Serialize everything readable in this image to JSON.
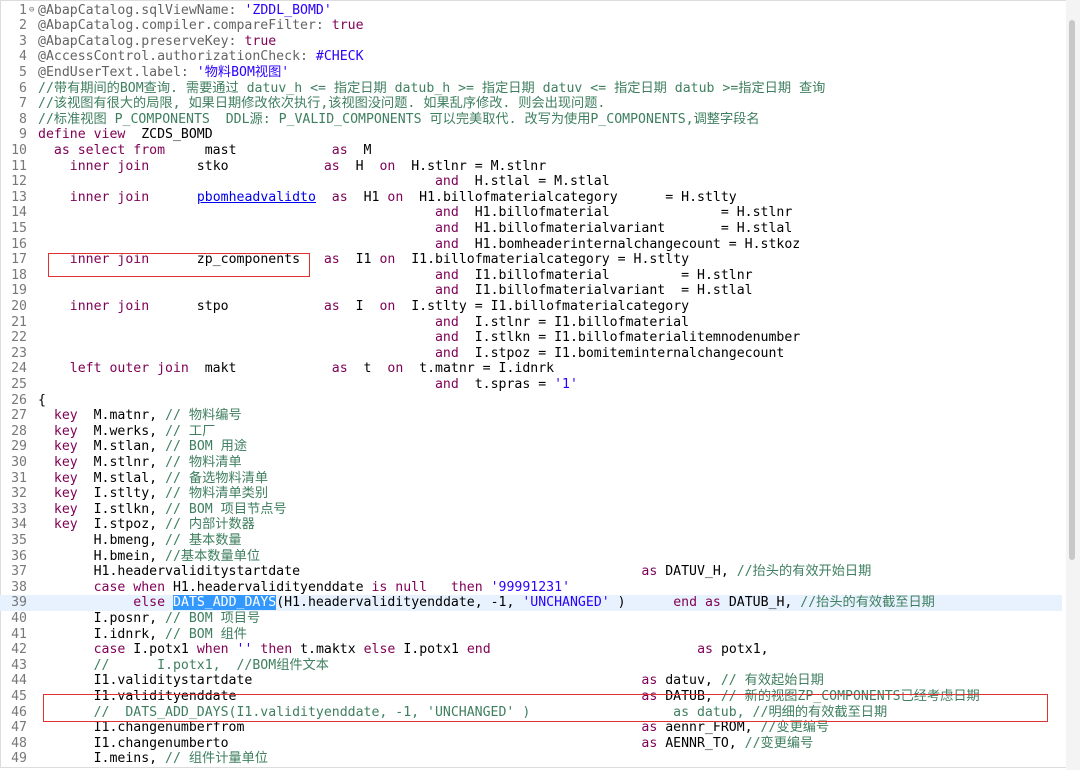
{
  "editor": {
    "lines": [
      [
        [
          "an",
          "@AbapCatalog.sqlViewName: "
        ],
        [
          "str",
          "'ZDDL_BOMD'"
        ]
      ],
      [
        [
          "an",
          "@AbapCatalog.compiler.compareFilter: "
        ],
        [
          "kw",
          "true"
        ]
      ],
      [
        [
          "an",
          "@AbapCatalog.preserveKey: "
        ],
        [
          "kw",
          "true"
        ]
      ],
      [
        [
          "an",
          "@AccessControl.authorizationCheck: "
        ],
        [
          "str",
          "#CHECK"
        ]
      ],
      [
        [
          "an",
          "@EndUserText.label: "
        ],
        [
          "str",
          "'物料BOM视图'"
        ]
      ],
      [
        [
          "cm",
          "//带有期间的BOM查询. 需要通过 datuv_h <= 指定日期 datub_h >= 指定日期 datuv <= 指定日期 datub >=指定日期 查询"
        ]
      ],
      [
        [
          "cm",
          "//该视图有很大的局限, 如果日期修改依次执行,该视图没问题. 如果乱序修改. 则会出现问题."
        ]
      ],
      [
        [
          "cm",
          "//标准视图 P_COMPONENTS  DDL源: P_VALID_COMPONENTS 可以完美取代. 改写为使用P_COMPONENTS,调整字段名"
        ]
      ],
      [
        [
          "kw",
          "define view"
        ],
        [
          "",
          "  ZCDS_BOMD"
        ]
      ],
      [
        [
          "",
          "  "
        ],
        [
          "kw",
          "as select from"
        ],
        [
          "",
          "     mast            "
        ],
        [
          "kw",
          "as"
        ],
        [
          "",
          "  M"
        ]
      ],
      [
        [
          "",
          "    "
        ],
        [
          "kw",
          "inner join"
        ],
        [
          "",
          "      stko            "
        ],
        [
          "kw",
          "as"
        ],
        [
          "",
          "  H  "
        ],
        [
          "kw",
          "on"
        ],
        [
          "",
          "  H.stlnr = M.stlnr"
        ]
      ],
      [
        [
          "",
          "                                                  "
        ],
        [
          "kw",
          "and"
        ],
        [
          "",
          "  H.stlal = M.stlal"
        ]
      ],
      [
        [
          "",
          "    "
        ],
        [
          "kw",
          "inner join"
        ],
        [
          "",
          "      "
        ],
        [
          "lnk",
          "pbomheadvalidto"
        ],
        [
          "",
          "  "
        ],
        [
          "kw",
          "as"
        ],
        [
          "",
          "  H1 "
        ],
        [
          "kw",
          "on"
        ],
        [
          "",
          "  H1.billofmaterialcategory      = H.stlty"
        ]
      ],
      [
        [
          "",
          "                                                  "
        ],
        [
          "kw",
          "and"
        ],
        [
          "",
          "  H1.billofmaterial              = H.stlnr"
        ]
      ],
      [
        [
          "",
          "                                                  "
        ],
        [
          "kw",
          "and"
        ],
        [
          "",
          "  H1.billofmaterialvariant       = H.stlal"
        ]
      ],
      [
        [
          "",
          "                                                  "
        ],
        [
          "kw",
          "and"
        ],
        [
          "",
          "  H1.bomheaderinternalchangecount = H.stkoz"
        ]
      ],
      [
        [
          "",
          "    "
        ],
        [
          "kw",
          "inner join"
        ],
        [
          "",
          "      zp_components   "
        ],
        [
          "kw",
          "as"
        ],
        [
          "",
          "  I1 "
        ],
        [
          "kw",
          "on"
        ],
        [
          "",
          "  I1.billofmaterialcategory = H.stlty"
        ]
      ],
      [
        [
          "",
          "                                                  "
        ],
        [
          "kw",
          "and"
        ],
        [
          "",
          "  I1.billofmaterial         = H.stlnr"
        ]
      ],
      [
        [
          "",
          "                                                  "
        ],
        [
          "kw",
          "and"
        ],
        [
          "",
          "  I1.billofmaterialvariant  = H.stlal"
        ]
      ],
      [
        [
          "",
          "    "
        ],
        [
          "kw",
          "inner join"
        ],
        [
          "",
          "      stpo            "
        ],
        [
          "kw",
          "as"
        ],
        [
          "",
          "  I  "
        ],
        [
          "kw",
          "on"
        ],
        [
          "",
          "  I.stlty = I1.billofmaterialcategory"
        ]
      ],
      [
        [
          "",
          "                                                  "
        ],
        [
          "kw",
          "and"
        ],
        [
          "",
          "  I.stlnr = I1.billofmaterial"
        ]
      ],
      [
        [
          "",
          "                                                  "
        ],
        [
          "kw",
          "and"
        ],
        [
          "",
          "  I.stlkn = I1.billofmaterialitemnodenumber"
        ]
      ],
      [
        [
          "",
          "                                                  "
        ],
        [
          "kw",
          "and"
        ],
        [
          "",
          "  I.stpoz = I1.bomiteminternalchangecount"
        ]
      ],
      [
        [
          "",
          "    "
        ],
        [
          "kw",
          "left outer join"
        ],
        [
          "",
          "  makt            "
        ],
        [
          "kw",
          "as"
        ],
        [
          "",
          "  t  "
        ],
        [
          "kw",
          "on"
        ],
        [
          "",
          "  t.matnr = I.idnrk"
        ]
      ],
      [
        [
          "",
          "                                                  "
        ],
        [
          "kw",
          "and"
        ],
        [
          "",
          "  t.spras = "
        ],
        [
          "str",
          "'1'"
        ]
      ],
      [
        [
          "",
          "{"
        ]
      ],
      [
        [
          "",
          "  "
        ],
        [
          "kw",
          "key"
        ],
        [
          "",
          "  M.matnr, "
        ],
        [
          "cm",
          "// 物料编号"
        ]
      ],
      [
        [
          "",
          "  "
        ],
        [
          "kw",
          "key"
        ],
        [
          "",
          "  M.werks, "
        ],
        [
          "cm",
          "// 工厂"
        ]
      ],
      [
        [
          "",
          "  "
        ],
        [
          "kw",
          "key"
        ],
        [
          "",
          "  M.stlan, "
        ],
        [
          "cm",
          "// BOM 用途"
        ]
      ],
      [
        [
          "",
          "  "
        ],
        [
          "kw",
          "key"
        ],
        [
          "",
          "  M.stlnr, "
        ],
        [
          "cm",
          "// 物料清单"
        ]
      ],
      [
        [
          "",
          "  "
        ],
        [
          "kw",
          "key"
        ],
        [
          "",
          "  M.stlal, "
        ],
        [
          "cm",
          "// 备选物料清单"
        ]
      ],
      [
        [
          "",
          "  "
        ],
        [
          "kw",
          "key"
        ],
        [
          "",
          "  I.stlty, "
        ],
        [
          "cm",
          "// 物料清单类别"
        ]
      ],
      [
        [
          "",
          "  "
        ],
        [
          "kw",
          "key"
        ],
        [
          "",
          "  I.stlkn, "
        ],
        [
          "cm",
          "// BOM 项目节点号"
        ]
      ],
      [
        [
          "",
          "  "
        ],
        [
          "kw",
          "key"
        ],
        [
          "",
          "  I.stpoz, "
        ],
        [
          "cm",
          "// 内部计数器"
        ]
      ],
      [
        [
          "",
          "       H.bmeng, "
        ],
        [
          "cm",
          "// 基本数量"
        ]
      ],
      [
        [
          "",
          "       H.bmein, "
        ],
        [
          "cm",
          "//基本数量单位"
        ]
      ],
      [
        [
          "",
          "       H1.headervaliditystartdate                                           "
        ],
        [
          "kw",
          "as"
        ],
        [
          "",
          " DATUV_H, "
        ],
        [
          "cm",
          "//抬头的有效开始日期"
        ]
      ],
      [
        [
          "",
          "       "
        ],
        [
          "kw",
          "case when"
        ],
        [
          "",
          " H1.headervalidityenddate "
        ],
        [
          "kw",
          "is null"
        ],
        [
          "",
          "   "
        ],
        [
          "kw",
          "then"
        ],
        [
          "",
          " "
        ],
        [
          "str",
          "'99991231'"
        ]
      ],
      [
        [
          "",
          "            "
        ],
        [
          "kw",
          "else"
        ],
        [
          "",
          " "
        ],
        [
          "sel",
          "DATS_ADD_DAYS"
        ],
        [
          "",
          "(H1.headervalidityenddate, -1, "
        ],
        [
          "str",
          "'UNCHANGED'"
        ],
        [
          "",
          " )      "
        ],
        [
          "kw",
          "end as"
        ],
        [
          "",
          " DATUB_H, "
        ],
        [
          "cm",
          "//抬头的有效截至日期"
        ]
      ],
      [
        [
          "",
          "       I.posnr, "
        ],
        [
          "cm",
          "// BOM 项目号"
        ]
      ],
      [
        [
          "",
          "       I.idnrk, "
        ],
        [
          "cm",
          "// BOM 组件"
        ]
      ],
      [
        [
          "",
          "       "
        ],
        [
          "kw",
          "case"
        ],
        [
          "",
          " I.potx1 "
        ],
        [
          "kw",
          "when"
        ],
        [
          "",
          " "
        ],
        [
          "str",
          "''"
        ],
        [
          "",
          " "
        ],
        [
          "kw",
          "then"
        ],
        [
          "",
          " t.maktx "
        ],
        [
          "kw",
          "else"
        ],
        [
          "",
          " I.potx1 "
        ],
        [
          "kw",
          "end"
        ],
        [
          "",
          "                          "
        ],
        [
          "kw",
          "as"
        ],
        [
          "",
          " potx1,"
        ]
      ],
      [
        [
          "",
          "       "
        ],
        [
          "cm",
          "//      I.potx1,  //BOM组件文本"
        ]
      ],
      [
        [
          "",
          "       I1.validitystartdate                                                 "
        ],
        [
          "kw",
          "as"
        ],
        [
          "",
          " datuv, "
        ],
        [
          "cm",
          "// 有效起始日期"
        ]
      ],
      [
        [
          "",
          "       I1.validityenddate                                                   "
        ],
        [
          "kw",
          "as"
        ],
        [
          "",
          " DATUB, "
        ],
        [
          "cm",
          "// 新的视图ZP_COMPONENTS已经考虑日期"
        ]
      ],
      [
        [
          "",
          "       "
        ],
        [
          "cm",
          "//  DATS_ADD_DAYS(I1.validityenddate, -1, 'UNCHANGED' )                  as datub, //明细的有效截至日期"
        ]
      ],
      [
        [
          "",
          "       I1.changenumberfrom                                                  "
        ],
        [
          "kw",
          "as"
        ],
        [
          "",
          " aennr_FROM, "
        ],
        [
          "cm",
          "//变更编号"
        ]
      ],
      [
        [
          "",
          "       I1.changenumberto                                                    "
        ],
        [
          "kw",
          "as"
        ],
        [
          "",
          " AENNR_TO, "
        ],
        [
          "cm",
          "//变更编号"
        ]
      ],
      [
        [
          "",
          "       I.meins, "
        ],
        [
          "cm",
          "// 组件计量单位"
        ]
      ]
    ]
  }
}
